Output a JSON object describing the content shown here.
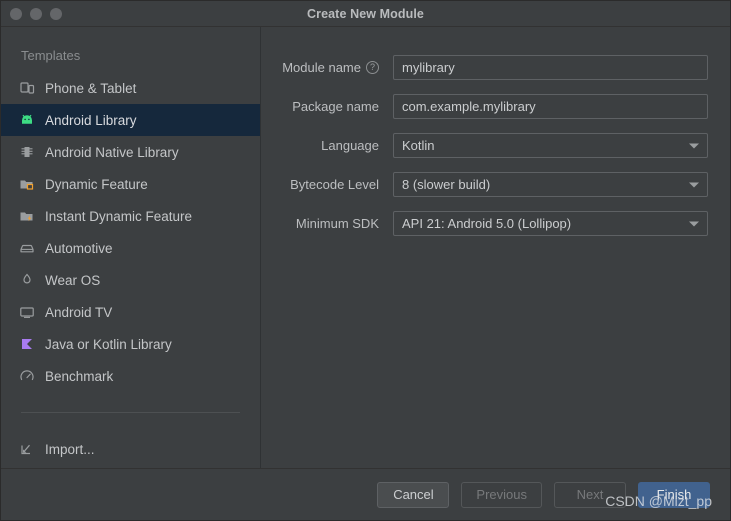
{
  "window": {
    "title": "Create New Module",
    "traffic_lights": [
      "close-button",
      "minimize-button",
      "maximize-button"
    ]
  },
  "sidebar": {
    "header": "Templates",
    "items": [
      {
        "label": "Phone & Tablet",
        "icon": "phone-tablet-icon",
        "selected": false
      },
      {
        "label": "Android Library",
        "icon": "android-robot-icon",
        "selected": true
      },
      {
        "label": "Android Native Library",
        "icon": "native-library-icon",
        "selected": false
      },
      {
        "label": "Dynamic Feature",
        "icon": "dynamic-feature-icon",
        "selected": false
      },
      {
        "label": "Instant Dynamic Feature",
        "icon": "instant-dynamic-feature-icon",
        "selected": false
      },
      {
        "label": "Automotive",
        "icon": "car-icon",
        "selected": false
      },
      {
        "label": "Wear OS",
        "icon": "watch-icon",
        "selected": false
      },
      {
        "label": "Android TV",
        "icon": "tv-icon",
        "selected": false
      },
      {
        "label": "Java or Kotlin Library",
        "icon": "kotlin-icon",
        "selected": false
      },
      {
        "label": "Benchmark",
        "icon": "benchmark-gauge-icon",
        "selected": false
      }
    ],
    "import": {
      "label": "Import...",
      "icon": "import-arrow-icon"
    }
  },
  "form": {
    "module_name": {
      "label": "Module name",
      "value": "mylibrary",
      "help_icon": "help-circle-icon",
      "type": "text"
    },
    "package_name": {
      "label": "Package name",
      "value": "com.example.mylibrary",
      "type": "text"
    },
    "language": {
      "label": "Language",
      "value": "Kotlin",
      "type": "combo"
    },
    "bytecode_level": {
      "label": "Bytecode Level",
      "value": "8 (slower build)",
      "type": "combo"
    },
    "minimum_sdk": {
      "label": "Minimum SDK",
      "value": "API 21: Android 5.0 (Lollipop)",
      "type": "combo"
    }
  },
  "footer": {
    "cancel": {
      "label": "Cancel",
      "state": "enabled"
    },
    "previous": {
      "label": "Previous",
      "state": "disabled"
    },
    "next": {
      "label": "Next",
      "state": "disabled"
    },
    "finish": {
      "label": "Finish",
      "state": "primary"
    }
  },
  "watermark": {
    "text": "CSDN @Mizt_pp"
  },
  "colors": {
    "window_bg": "#3c3f41",
    "selected_row": "#15283c",
    "primary_button": "#41628e",
    "android_green": "#3ddc84",
    "kotlin_purple": "#a97bf0",
    "accent_orange": "#f0a030"
  }
}
